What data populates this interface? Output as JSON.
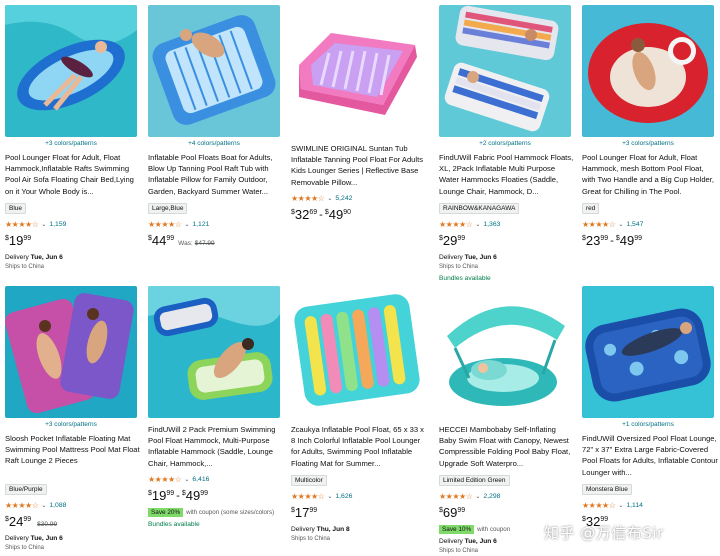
{
  "products": [
    {
      "colors": "+3 colors/patterns",
      "title": "Pool Lounger Float for Adult, Float Hammock,Inflatable Rafts Swimming Pool Air Sofa Floating Chair Bed,Lying on it Your Whole Body is...",
      "tag": "Blue",
      "rating_count": "1,159",
      "rating": 4.5,
      "price_dollar": "$",
      "price_whole": "19",
      "price_cents": "99",
      "delivery_label": "Delivery",
      "delivery_date": "Tue, Jun 6",
      "ships": "Ships to China"
    },
    {
      "colors": "+4 colors/patterns",
      "title": "Inflatable Pool Floats Boat for Adults, Blow Up Tanning Pool Raft Tub with Inflatable Pillow for Family Outdoor, Garden, Backyard Summer Water...",
      "tag": "Large,Blue",
      "rating_count": "1,121",
      "rating": 4.5,
      "price_dollar": "$",
      "price_whole": "44",
      "price_cents": "99",
      "was_label": "Was:",
      "was_price": "$47.99"
    },
    {
      "colors": "",
      "title": "SWIMLINE ORIGINAL Suntan Tub Inflatable Tanning Pool Float For Adults Kids Lounger Series | Reflective Base Removable Pillow...",
      "rating_count": "5,242",
      "rating": 4.5,
      "price_dollar": "$",
      "price_whole": "32",
      "price_cents": "69",
      "price2_dollar": "$",
      "price2_whole": "49",
      "price2_cents": "90"
    },
    {
      "colors": "+2 colors/patterns",
      "title": "FindUWill Fabric Pool Hammock Floats, XL, 2Pack Inflatable Multi Purpose Water Hammocks Floaties (Saddle, Lounge Chair, Hammock, D...",
      "tag": "RAINBOW&KANAGAWA",
      "rating_count": "1,363",
      "rating": 4.5,
      "price_dollar": "$",
      "price_whole": "29",
      "price_cents": "99",
      "delivery_label": "Delivery",
      "delivery_date": "Tue, Jun 6",
      "ships": "Ships to China",
      "bundle": "Bundles available"
    },
    {
      "colors": "+3 colors/patterns",
      "title": "Pool Lounger Float for Adult, Float Hammock, mesh Bottom Pool Float, with Two Handle and a Big Cup Holder, Great for Chilling in The Pool.",
      "tag": "red",
      "rating_count": "1,547",
      "rating": 4.5,
      "price_dollar": "$",
      "price_whole": "23",
      "price_cents": "99",
      "price2_dollar": "$",
      "price2_whole": "49",
      "price2_cents": "99"
    },
    {
      "colors": "+3 colors/patterns",
      "title": "Sloosh Pocket Inflatable Floating Mat Swimming Pool Mattress Pool Mat Float Raft Lounge 2 Pieces",
      "tag": "Blue/Purple",
      "rating_count": "1,088",
      "rating": 4.5,
      "price_dollar": "$",
      "price_whole": "24",
      "price_cents": "99",
      "was_price": "$30.99",
      "delivery_label": "Delivery",
      "delivery_date": "Tue, Jun 6",
      "ships": "Ships to China"
    },
    {
      "colors": "",
      "title": "FindUWill 2 Pack Premium Swimming Pool Float Hammock, Multi-Purpose Inflatable Hammock (Saddle, Lounge Chair, Hammock,...",
      "rating_count": "6,416",
      "rating": 4.5,
      "price_dollar": "$",
      "price_whole": "19",
      "price_cents": "99",
      "price2_dollar": "$",
      "price2_whole": "49",
      "price2_cents": "99",
      "save_badge": "Save 20%",
      "save_text": "with coupon (some sizes/colors)",
      "bundle": "Bundles available"
    },
    {
      "colors": "",
      "title": "Zcaukya Inflatable Pool Float, 65 x 33 x 8 Inch Colorful Inflatable Pool Lounger for Adults, Swimming Pool Inflatable Floating Mat for Summer...",
      "tag": "Multicolor",
      "rating_count": "1,626",
      "rating": 4.0,
      "price_dollar": "$",
      "price_whole": "17",
      "price_cents": "99",
      "delivery_label": "Delivery",
      "delivery_date": "Thu, Jun 8",
      "ships": "Ships to China"
    },
    {
      "colors": "",
      "title": "HECCEI Mambobaby Self-Inflating Baby Swim Float with Canopy, Newest Compressible Folding Pool Baby Float, Upgrade Soft Waterpro...",
      "tag": "Limited Edition Green",
      "rating_count": "2,298",
      "rating": 4.5,
      "price_dollar": "$",
      "price_whole": "69",
      "price_cents": "99",
      "save_badge": "Save 10%",
      "save_text": "with coupon",
      "delivery_label": "Delivery",
      "delivery_date": "Tue, Jun 6",
      "ships": "Ships to China"
    },
    {
      "colors": "+1 colors/patterns",
      "title": "FindUWill Oversized Pool Float Lounge, 72\" x 37\" Extra Large Fabric-Covered Pool Floats for Adults, Inflatable Contour Lounger with...",
      "tag": "Monstera Blue",
      "rating_count": "1,114",
      "rating": 4.5,
      "price_dollar": "$",
      "price_whole": "32",
      "price_cents": "99"
    }
  ],
  "watermark": "知乎 @万信布Sir",
  "palette": {
    "link": "#007185",
    "star": "#de7921",
    "save_badge": "#7fda69",
    "bundle": "#007b4a"
  }
}
